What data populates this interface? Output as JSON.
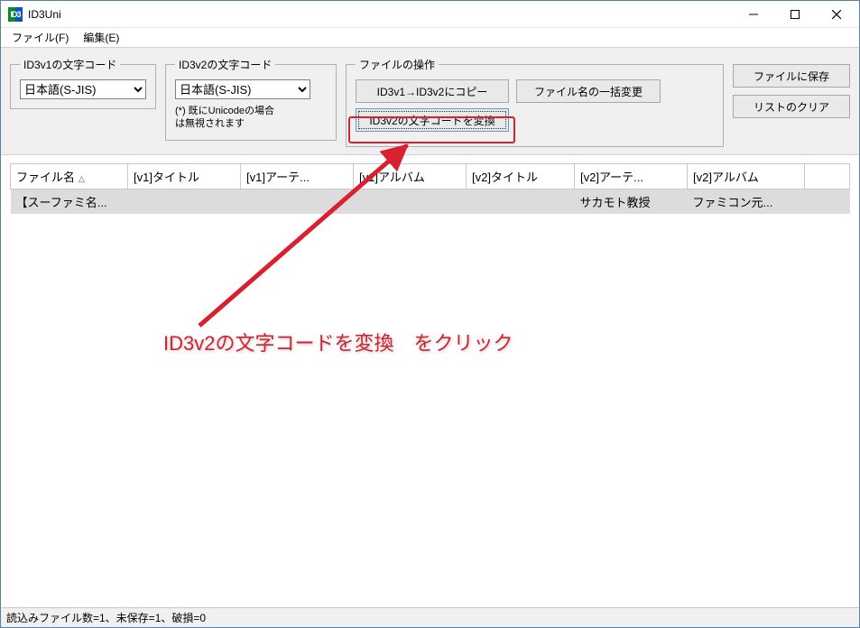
{
  "window": {
    "title": "ID3Uni"
  },
  "menu": {
    "file": "ファイル(F)",
    "edit": "編集(E)"
  },
  "groups": {
    "id3v1": {
      "legend": "ID3v1の文字コード",
      "select_value": "日本語(S-JIS)"
    },
    "id3v2": {
      "legend": "ID3v2の文字コード",
      "select_value": "日本語(S-JIS)",
      "note": "(*) 既にUnicodeの場合\nは無視されます"
    },
    "fileops": {
      "legend": "ファイルの操作",
      "copy_btn": "ID3v1→ID3v2にコピー",
      "rename_btn": "ファイル名の一括変更",
      "convert_btn": "ID3v2の文字コードを変換"
    }
  },
  "side": {
    "save_btn": "ファイルに保存",
    "clear_btn": "リストのクリア"
  },
  "table": {
    "columns": {
      "filename": "ファイル名",
      "v1_title": "[v1]タイトル",
      "v1_artist": "[v1]アーテ...",
      "v1_album": "[v1]アルバム",
      "v2_title": "[v2]タイトル",
      "v2_artist": "[v2]アーテ...",
      "v2_album": "[v2]アルバム"
    },
    "sort_indicator": "△",
    "rows": [
      {
        "filename": "【スーファミ名...",
        "v1_title": "",
        "v1_artist": "",
        "v1_album": "",
        "v2_title": "",
        "v2_artist": "サカモト教授",
        "v2_album": "ファミコン元..."
      }
    ]
  },
  "status": {
    "text": "読込みファイル数=1、未保存=1、破損=0"
  },
  "annotation": {
    "text": "ID3v2の文字コードを変換　をクリック"
  },
  "colors": {
    "accent_red": "#d8202f",
    "chrome_bg": "#f0f0f0"
  }
}
